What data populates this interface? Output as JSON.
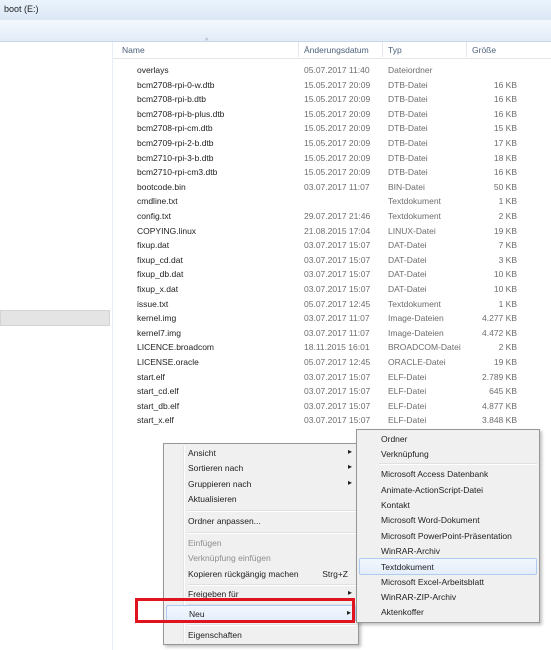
{
  "window": {
    "title": "boot (E:)"
  },
  "columns": {
    "name": "Name",
    "date": "Änderungsdatum",
    "type": "Typ",
    "size": "Größe"
  },
  "files": [
    {
      "name": "overlays",
      "date": "05.07.2017 11:40",
      "type": "Dateiordner",
      "size": ""
    },
    {
      "name": "bcm2708-rpi-0-w.dtb",
      "date": "15.05.2017 20:09",
      "type": "DTB-Datei",
      "size": "16 KB"
    },
    {
      "name": "bcm2708-rpi-b.dtb",
      "date": "15.05.2017 20:09",
      "type": "DTB-Datei",
      "size": "16 KB"
    },
    {
      "name": "bcm2708-rpi-b-plus.dtb",
      "date": "15.05.2017 20:09",
      "type": "DTB-Datei",
      "size": "16 KB"
    },
    {
      "name": "bcm2708-rpi-cm.dtb",
      "date": "15.05.2017 20:09",
      "type": "DTB-Datei",
      "size": "15 KB"
    },
    {
      "name": "bcm2709-rpi-2-b.dtb",
      "date": "15.05.2017 20:09",
      "type": "DTB-Datei",
      "size": "17 KB"
    },
    {
      "name": "bcm2710-rpi-3-b.dtb",
      "date": "15.05.2017 20:09",
      "type": "DTB-Datei",
      "size": "18 KB"
    },
    {
      "name": "bcm2710-rpi-cm3.dtb",
      "date": "15.05.2017 20:09",
      "type": "DTB-Datei",
      "size": "16 KB"
    },
    {
      "name": "bootcode.bin",
      "date": "03.07.2017 11:07",
      "type": "BIN-Datei",
      "size": "50 KB"
    },
    {
      "name": "cmdline.txt",
      "date": "",
      "type": "Textdokument",
      "size": "1 KB"
    },
    {
      "name": "config.txt",
      "date": "29.07.2017 21:46",
      "type": "Textdokument",
      "size": "2 KB"
    },
    {
      "name": "COPYING.linux",
      "date": "21.08.2015 17:04",
      "type": "LINUX-Datei",
      "size": "19 KB"
    },
    {
      "name": "fixup.dat",
      "date": "03.07.2017 15:07",
      "type": "DAT-Datei",
      "size": "7 KB"
    },
    {
      "name": "fixup_cd.dat",
      "date": "03.07.2017 15:07",
      "type": "DAT-Datei",
      "size": "3 KB"
    },
    {
      "name": "fixup_db.dat",
      "date": "03.07.2017 15:07",
      "type": "DAT-Datei",
      "size": "10 KB"
    },
    {
      "name": "fixup_x.dat",
      "date": "03.07.2017 15:07",
      "type": "DAT-Datei",
      "size": "10 KB"
    },
    {
      "name": "issue.txt",
      "date": "05.07.2017 12:45",
      "type": "Textdokument",
      "size": "1 KB"
    },
    {
      "name": "kernel.img",
      "date": "03.07.2017 11:07",
      "type": "Image-Dateien",
      "size": "4.277 KB"
    },
    {
      "name": "kernel7.img",
      "date": "03.07.2017 11:07",
      "type": "Image-Dateien",
      "size": "4.472 KB"
    },
    {
      "name": "LICENCE.broadcom",
      "date": "18.11.2015 16:01",
      "type": "BROADCOM-Datei",
      "size": "2 KB"
    },
    {
      "name": "LICENSE.oracle",
      "date": "05.07.2017 12:45",
      "type": "ORACLE-Datei",
      "size": "19 KB"
    },
    {
      "name": "start.elf",
      "date": "03.07.2017 15:07",
      "type": "ELF-Datei",
      "size": "2.789 KB"
    },
    {
      "name": "start_cd.elf",
      "date": "03.07.2017 15:07",
      "type": "ELF-Datei",
      "size": "645 KB"
    },
    {
      "name": "start_db.elf",
      "date": "03.07.2017 15:07",
      "type": "ELF-Datei",
      "size": "4.877 KB"
    },
    {
      "name": "start_x.elf",
      "date": "03.07.2017 15:07",
      "type": "ELF-Datei",
      "size": "3.848 KB"
    }
  ],
  "context_menu": {
    "ansicht": "Ansicht",
    "sortieren": "Sortieren nach",
    "gruppieren": "Gruppieren nach",
    "aktualisieren": "Aktualisieren",
    "ordner_anpassen": "Ordner anpassen...",
    "einfuegen": "Einfügen",
    "verknuepfung_einfuegen": "Verknüpfung einfügen",
    "rueckgaengig": "Kopieren rückgängig machen",
    "rueckgaengig_shortcut": "Strg+Z",
    "freigeben": "Freigeben für",
    "neu": "Neu",
    "eigenschaften": "Eigenschaften"
  },
  "new_submenu": {
    "ordner": "Ordner",
    "verknuepfung": "Verknüpfung",
    "access": "Microsoft Access Datenbank",
    "animate": "Animate-ActionScript-Datei",
    "kontakt": "Kontakt",
    "word": "Microsoft Word-Dokument",
    "powerpoint": "Microsoft PowerPoint-Präsentation",
    "winrar": "WinRAR-Archiv",
    "textdokument": "Textdokument",
    "excel": "Microsoft Excel-Arbeitsblatt",
    "winrar_zip": "WinRAR-ZIP-Archiv",
    "aktenkoffer": "Aktenkoffer"
  },
  "icons": {
    "submenu_arrow": "▸",
    "sort_arrow": "^"
  },
  "colors": {
    "highlight_box": "#e0141e",
    "header_text": "#4c607a"
  }
}
